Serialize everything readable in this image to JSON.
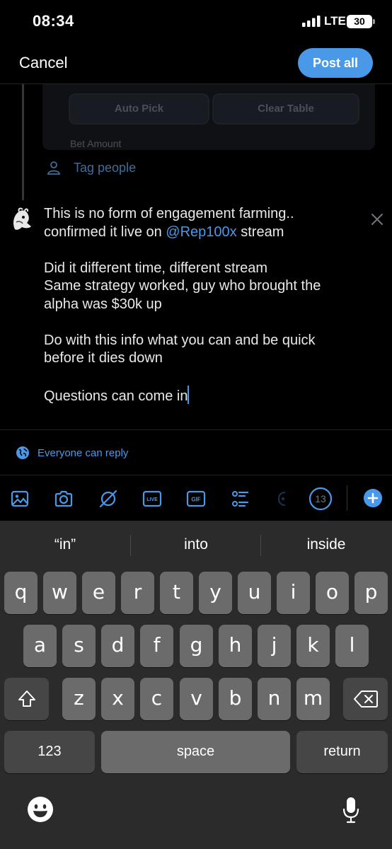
{
  "status": {
    "time": "08:34",
    "network": "LTE",
    "battery": "30"
  },
  "header": {
    "cancel_label": "Cancel",
    "post_all_label": "Post all"
  },
  "embed": {
    "auto_pick": "Auto Pick",
    "clear_table": "Clear Table",
    "bet_amount": "Bet Amount"
  },
  "tag_people": "Tag people",
  "tweet": {
    "line1": "This is no form of engagement farming..",
    "line2_before": "confirmed it live on ",
    "mention": "@Rep100x",
    "line2_after": " stream",
    "para2_l1": "Did it different time, different stream",
    "para2_l2": "Same strategy worked, guy who brought the",
    "para2_l3": "alpha was $30k up",
    "para3_l1": "Do with this info what you can and be quick",
    "para3_l2": "before it dies down",
    "para4": "Questions can come in"
  },
  "reply_setting": "Everyone can reply",
  "toolbar": {
    "icons": [
      "image-icon",
      "camera-icon",
      "grok-icon",
      "live-icon",
      "gif-icon",
      "poll-icon",
      "location-icon"
    ],
    "live_label": "LIVE",
    "gif_label": "GIF",
    "char_remaining": "13"
  },
  "keyboard": {
    "suggestions": [
      "“in”",
      "into",
      "inside"
    ],
    "row1": [
      "q",
      "w",
      "e",
      "r",
      "t",
      "y",
      "u",
      "i",
      "o",
      "p"
    ],
    "row2": [
      "a",
      "s",
      "d",
      "f",
      "g",
      "h",
      "j",
      "k",
      "l"
    ],
    "row3": [
      "z",
      "x",
      "c",
      "v",
      "b",
      "n",
      "m"
    ],
    "numbers_label": "123",
    "space_label": "space",
    "return_label": "return"
  },
  "colors": {
    "accent": "#4a99e9",
    "background": "#000000",
    "keyboard_bg": "#2b2b2b",
    "key_bg": "#6b6b6b"
  }
}
